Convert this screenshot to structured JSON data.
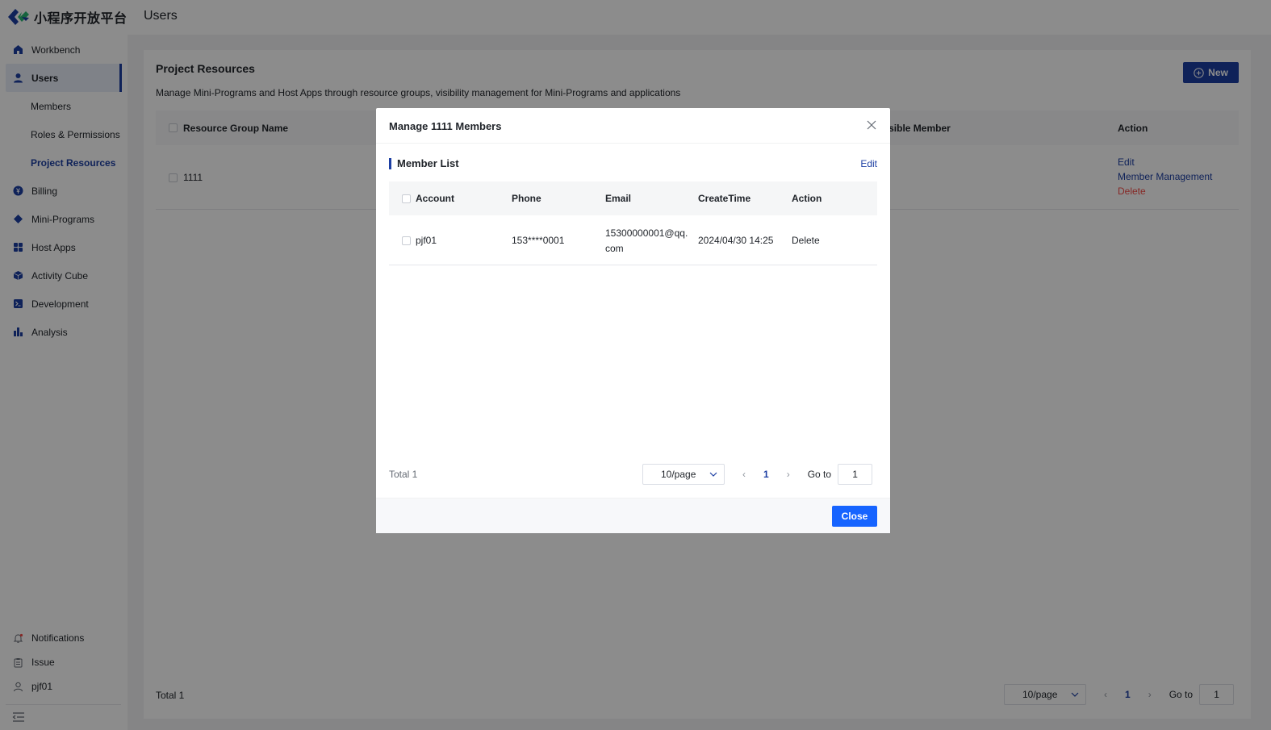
{
  "app": {
    "logo_text": "小程序开放平台"
  },
  "header": {
    "title": "Users"
  },
  "sidebar": {
    "items": [
      {
        "label": "Workbench",
        "icon": "home-icon"
      },
      {
        "label": "Users",
        "icon": "user-icon"
      },
      {
        "label": "Members"
      },
      {
        "label": "Roles & Permissions"
      },
      {
        "label": "Project Resources"
      },
      {
        "label": "Billing",
        "icon": "yen-icon"
      },
      {
        "label": "Mini-Programs",
        "icon": "diamond-icon"
      },
      {
        "label": "Host Apps",
        "icon": "grid-icon"
      },
      {
        "label": "Activity Cube",
        "icon": "cube-icon"
      },
      {
        "label": "Development",
        "icon": "terminal-icon"
      },
      {
        "label": "Analysis",
        "icon": "bar-chart-icon"
      }
    ],
    "bottom": [
      {
        "label": "Notifications",
        "icon": "bell-icon"
      },
      {
        "label": "Issue",
        "icon": "clipboard-icon"
      },
      {
        "label": "pjf01",
        "icon": "user-outline-icon"
      }
    ]
  },
  "main": {
    "title": "Project Resources",
    "description": "Manage Mini-Programs and Host Apps through resource groups, visibility management for Mini-Programs and applications",
    "new_button": "New",
    "columns": {
      "name": "Resource Group Name",
      "visible": "Visible Member",
      "action": "Action"
    },
    "rows": [
      {
        "name": "1111",
        "actions": {
          "edit": "Edit",
          "manage": "Member Management",
          "delete": "Delete"
        }
      }
    ],
    "total": "Total 1",
    "page_size": "10/page",
    "page": "1",
    "goto_label": "Go to",
    "goto_value": "1"
  },
  "modal": {
    "title": "Manage 1111 Members",
    "section_title": "Member List",
    "edit": "Edit",
    "columns": {
      "account": "Account",
      "phone": "Phone",
      "email": "Email",
      "create_time": "CreateTime",
      "action": "Action"
    },
    "rows": [
      {
        "account": "pjf01",
        "phone": "153****0001",
        "email_line1": "15300000001@qq.",
        "email_line2": "com",
        "create_time": "2024/04/30 14:25",
        "action": "Delete"
      }
    ],
    "total": "Total 1",
    "page_size": "10/page",
    "page": "1",
    "goto_label": "Go to",
    "goto_value": "1",
    "close_button": "Close"
  },
  "colors": {
    "primary": "#1d3fa3",
    "button_blue": "#1664ff",
    "danger": "#f54a45"
  }
}
